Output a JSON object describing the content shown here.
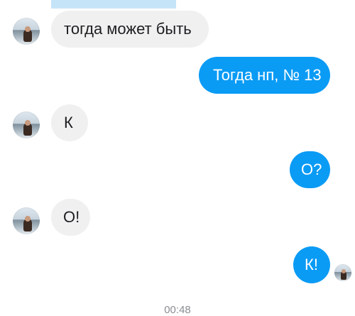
{
  "messages": [
    {
      "side": "incoming",
      "text": "тогда может быть"
    },
    {
      "side": "outgoing",
      "text": "Тогда нп, № 13"
    },
    {
      "side": "incoming",
      "text": "К"
    },
    {
      "side": "outgoing",
      "text": "О?"
    },
    {
      "side": "incoming",
      "text": "О!"
    },
    {
      "side": "outgoing",
      "text": "К!"
    }
  ],
  "timestamp": "00:48",
  "colors": {
    "outgoing_bubble": "#0a9bf5",
    "incoming_bubble": "#f1f0f0",
    "previous_bubble_strip": "#c6e4f8"
  },
  "icons": {
    "contact_avatar": "avatar-photo",
    "read_receipt": "seen-avatar-photo"
  }
}
